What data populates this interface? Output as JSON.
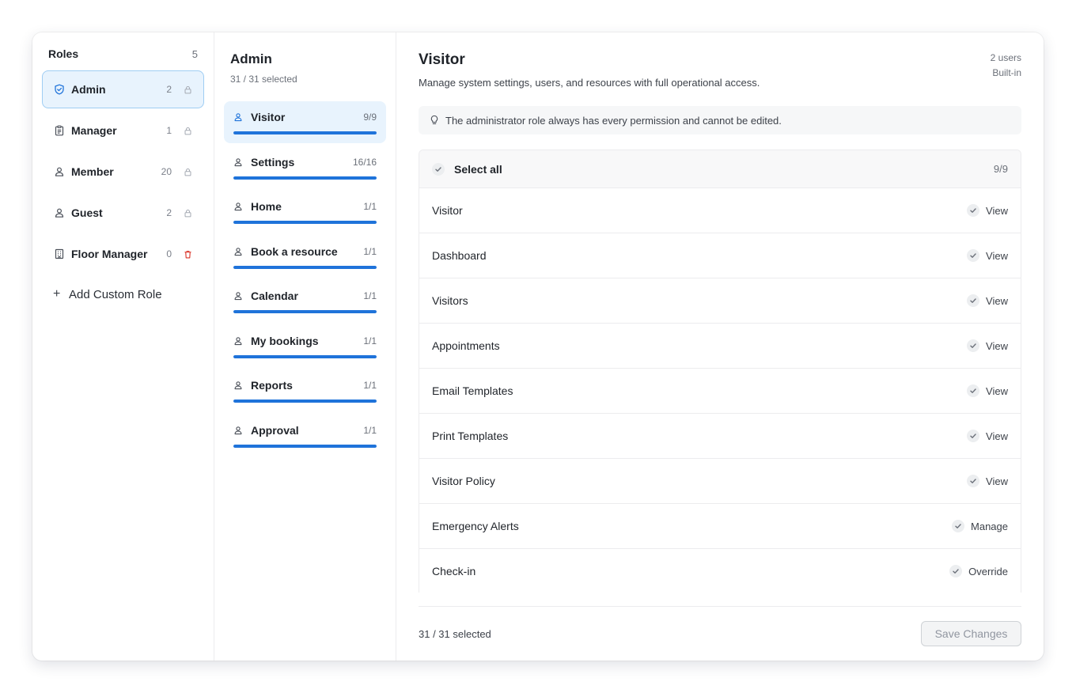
{
  "roles": {
    "title": "Roles",
    "count": "5",
    "items": [
      {
        "name": "Admin",
        "count": "2",
        "icon": "shield-icon",
        "action": "lock-icon"
      },
      {
        "name": "Manager",
        "count": "1",
        "icon": "clipboard-icon",
        "action": "lock-icon"
      },
      {
        "name": "Member",
        "count": "20",
        "icon": "user-icon",
        "action": "lock-icon"
      },
      {
        "name": "Guest",
        "count": "2",
        "icon": "user-icon",
        "action": "lock-icon"
      },
      {
        "name": "Floor Manager",
        "count": "0",
        "icon": "building-icon",
        "action": "trash-icon"
      }
    ],
    "add_label": "Add Custom Role"
  },
  "modules": {
    "title": "Admin",
    "selected": "31 / 31 selected",
    "items": [
      {
        "name": "Visitor",
        "count": "9/9",
        "progress": 1.0
      },
      {
        "name": "Settings",
        "count": "16/16",
        "progress": 1.0
      },
      {
        "name": "Home",
        "count": "1/1",
        "progress": 1.0
      },
      {
        "name": "Book a resource",
        "count": "1/1",
        "progress": 1.0
      },
      {
        "name": "Calendar",
        "count": "1/1",
        "progress": 1.0
      },
      {
        "name": "My bookings",
        "count": "1/1",
        "progress": 1.0
      },
      {
        "name": "Reports",
        "count": "1/1",
        "progress": 1.0
      },
      {
        "name": "Approval",
        "count": "1/1",
        "progress": 1.0
      }
    ]
  },
  "detail": {
    "title": "Visitor",
    "description": "Manage system settings, users, and resources with full operational access.",
    "users": "2 users",
    "type": "Built-in",
    "notice": "The administrator role always has every permission and cannot be edited.",
    "select_all_label": "Select all",
    "select_all_count": "9/9",
    "permissions": [
      {
        "name": "Visitor",
        "action": "View"
      },
      {
        "name": "Dashboard",
        "action": "View"
      },
      {
        "name": "Visitors",
        "action": "View"
      },
      {
        "name": "Appointments",
        "action": "View"
      },
      {
        "name": "Email Templates",
        "action": "View"
      },
      {
        "name": "Print Templates",
        "action": "View"
      },
      {
        "name": "Visitor Policy",
        "action": "View"
      },
      {
        "name": "Emergency Alerts",
        "action": "Manage"
      },
      {
        "name": "Check-in",
        "action": "Override"
      }
    ]
  },
  "footer": {
    "selected": "31 / 31 selected",
    "save_label": "Save Changes"
  },
  "colors": {
    "accent": "#1f73da",
    "active_bg": "#e8f3fd",
    "danger": "#d93025"
  }
}
